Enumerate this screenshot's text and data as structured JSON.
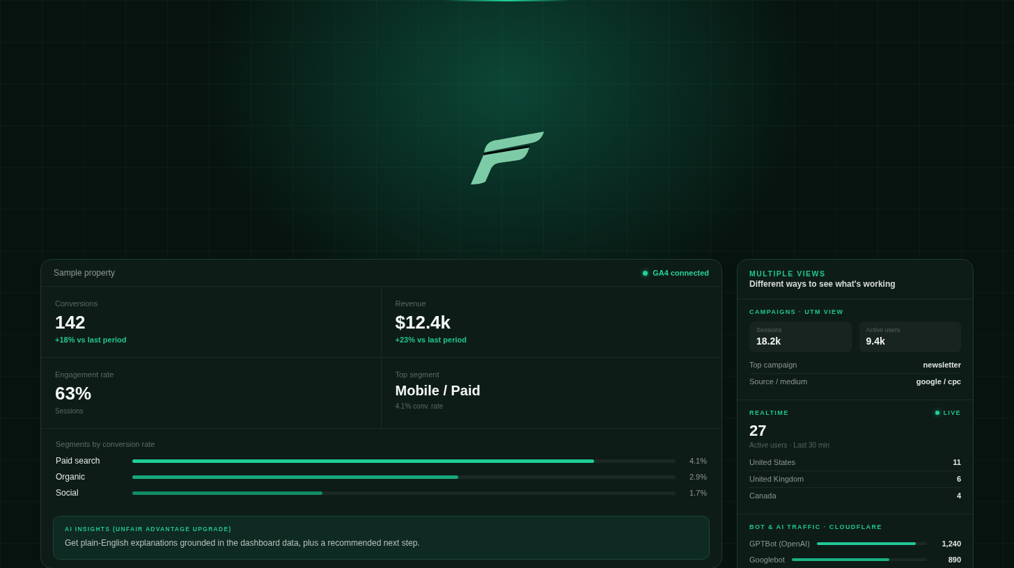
{
  "main_card": {
    "property": "Sample property",
    "status": {
      "label": "GA4 connected",
      "connected": true
    },
    "metrics": [
      {
        "kind": "trend",
        "label": "Conversions",
        "value": "142",
        "note": "+18% vs last period"
      },
      {
        "kind": "trend",
        "label": "Revenue",
        "value": "$12.4k",
        "note": "+23% vs last period"
      },
      {
        "kind": "caption",
        "label": "Engagement rate",
        "value": "63%",
        "note": "Sessions"
      },
      {
        "kind": "segment",
        "label": "Top segment",
        "value": "Mobile / Paid",
        "note": "4.1% conv. rate"
      }
    ],
    "segments": {
      "title": "Segments by conversion rate",
      "rows": [
        {
          "name": "Paid search",
          "level": 0.85,
          "reading": "4.1%",
          "color": "#1fcf98"
        },
        {
          "name": "Organic",
          "level": 0.6,
          "reading": "2.9%",
          "color": "#17a77c"
        },
        {
          "name": "Social",
          "level": 0.35,
          "reading": "1.7%",
          "color": "#128a66"
        }
      ]
    },
    "insight": {
      "title": "AI INSIGHTS (UNFAIR ADVANTAGE UPGRADE)",
      "text": "Get plain-English explanations grounded in the dashboard data, plus a recommended next step."
    }
  },
  "views_card": {
    "eyebrow": "MULTIPLE VIEWS",
    "title": "Different ways to see what's working",
    "campaigns": {
      "title": "CAMPAIGNS · UTM VIEW",
      "tiles": [
        {
          "label": "Sessions",
          "value": "18.2k"
        },
        {
          "label": "Active users",
          "value": "9.4k"
        }
      ],
      "rows": [
        {
          "label": "Top campaign",
          "value": "newsletter"
        },
        {
          "label": "Source / medium",
          "value": "google / cpc"
        }
      ]
    },
    "realtime": {
      "title": "REALTIME",
      "badge": {
        "label": "LIVE",
        "live": true
      },
      "count": "27",
      "caption": "Active users · Last 30 min",
      "rows": [
        {
          "label": "United States",
          "value": "11"
        },
        {
          "label": "United Kingdom",
          "value": "6"
        },
        {
          "label": "Canada",
          "value": "4"
        }
      ]
    },
    "bots": {
      "title": "BOT & AI TRAFFIC · CLOUDFLARE",
      "rows": [
        {
          "name": "GPTBot (OpenAI)",
          "level": 0.9,
          "reading": "1,240",
          "color": "#20c997"
        },
        {
          "name": "Googlebot",
          "level": 0.72,
          "reading": "890",
          "color": "#19b184"
        }
      ]
    }
  }
}
